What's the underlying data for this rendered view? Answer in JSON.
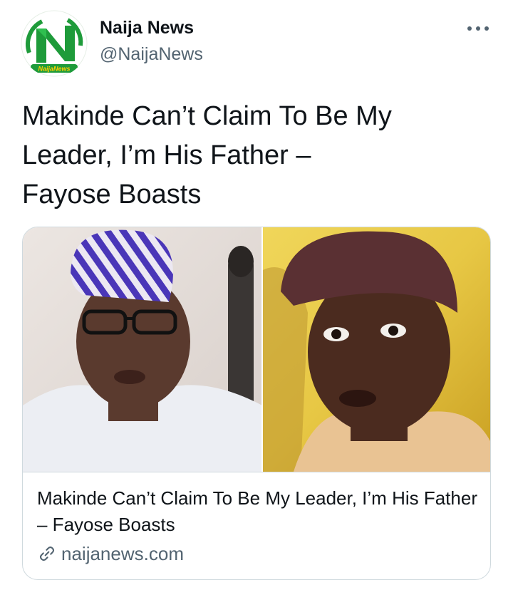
{
  "author": {
    "display_name": "Naija News",
    "handle": "@NaijaNews",
    "avatar_icon": "naija-news-logo",
    "logo_text": "NaijaNews"
  },
  "tweet": {
    "text": "Makinde Can’t Claim To Be My\nLeader, I’m His Father –\nFayose Boasts"
  },
  "card": {
    "title": "Makinde Can’t Claim To Be My Leader, I’m His Father – Fayose Boasts",
    "domain": "naijanews.com",
    "link_icon": "link-icon"
  },
  "menu_icon": "more-options-icon",
  "colors": {
    "text_primary": "#0f1419",
    "text_secondary": "#536471",
    "border": "#cfd9de",
    "brand_green": "#1e9b3a"
  }
}
